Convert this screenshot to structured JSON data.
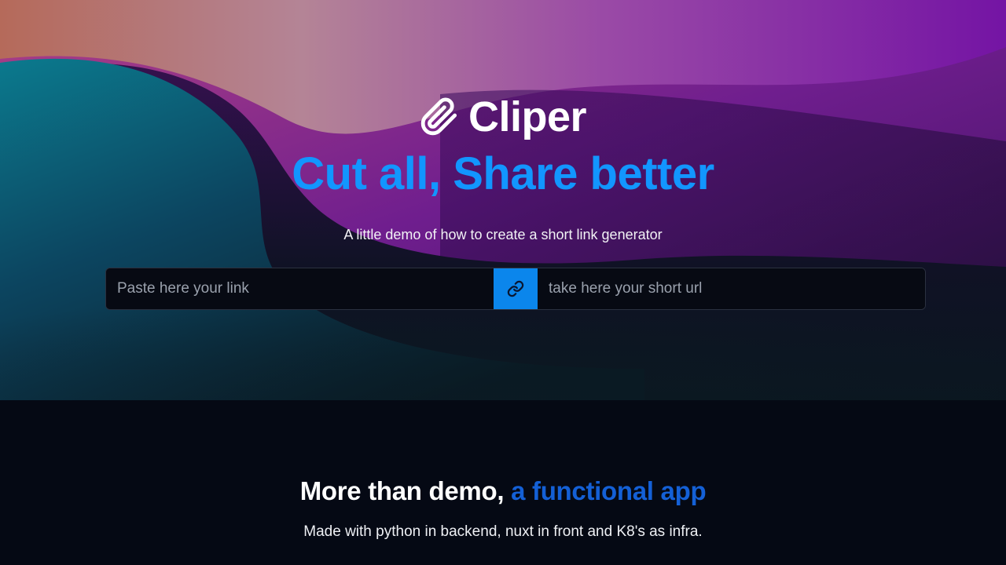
{
  "brand": {
    "name": "Cliper",
    "icon": "paperclip-icon"
  },
  "hero": {
    "tagline": "Cut all, Share better",
    "subtitle": "A little demo of how to create a short link generator"
  },
  "shortener": {
    "link_placeholder": "Paste here your link",
    "button_icon": "link-icon",
    "result_placeholder": "take here your short url"
  },
  "features": {
    "title_plain": "More than demo,",
    "title_highlight": "a functional app",
    "description": "Made with python in backend, nuxt in front and K8's as infra."
  },
  "colors": {
    "accent": "#1296ff",
    "button": "#0b86ec",
    "highlight": "#1460d6",
    "background": "#050914"
  }
}
